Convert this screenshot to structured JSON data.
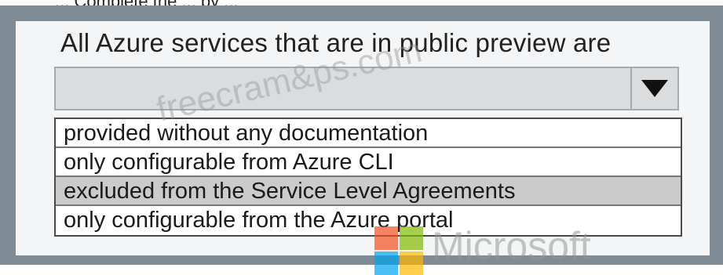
{
  "header": {
    "partial_text": "... Complete the ... by ..."
  },
  "question": {
    "text": "All Azure services that are in public preview are"
  },
  "dropdown": {
    "selected_value": "",
    "options": [
      {
        "label": "provided without any documentation",
        "highlighted": false
      },
      {
        "label": "only configurable from Azure CLI",
        "highlighted": false
      },
      {
        "label": "excluded from the Service Level Agreements",
        "highlighted": true
      },
      {
        "label": "only configurable from the Azure portal",
        "highlighted": false
      }
    ]
  },
  "watermark": {
    "text": "freecram&ps.com"
  },
  "brand": {
    "name": "Microsoft",
    "logo_colors": [
      "#f25022",
      "#7fba00",
      "#00a4ef",
      "#ffb900"
    ]
  }
}
